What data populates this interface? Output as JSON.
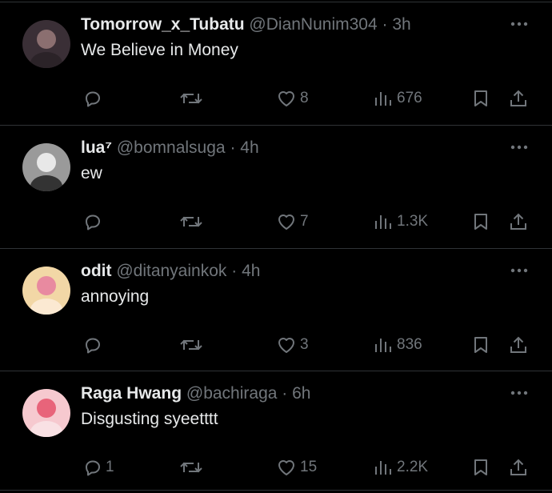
{
  "tweets": [
    {
      "name": "Tomorrow_x_Tubatu",
      "handle": "@DianNunim304",
      "sep": "·",
      "time": "3h",
      "text": "We Believe in Money",
      "replies": "",
      "likes": "8",
      "views": "676",
      "avatar_colors": [
        "#3a2f36",
        "#8b6f70",
        "#2b2328"
      ]
    },
    {
      "name": "lua⁷",
      "handle": "@bomnalsuga",
      "sep": "·",
      "time": "4h",
      "text": "ew",
      "replies": "",
      "likes": "7",
      "views": "1.3K",
      "avatar_colors": [
        "#9a9a9a",
        "#e8e8e8",
        "#333333"
      ]
    },
    {
      "name": "odit",
      "handle": "@ditanyainkok",
      "sep": "·",
      "time": "4h",
      "text": "annoying",
      "replies": "",
      "likes": "3",
      "views": "836",
      "avatar_colors": [
        "#f2d7a6",
        "#e88aa0",
        "#fbe9d2"
      ]
    },
    {
      "name": "Raga Hwang",
      "handle": "@bachiraga",
      "sep": "·",
      "time": "6h",
      "text": "Disgusting syeetttt",
      "replies": "1",
      "likes": "15",
      "views": "2.2K",
      "avatar_colors": [
        "#f6c9cf",
        "#e8647a",
        "#f9e1e4"
      ]
    }
  ],
  "colors": {
    "background": "#000000",
    "text": "#e7e9ea",
    "secondary": "#71767b",
    "divider": "#2f3336"
  }
}
